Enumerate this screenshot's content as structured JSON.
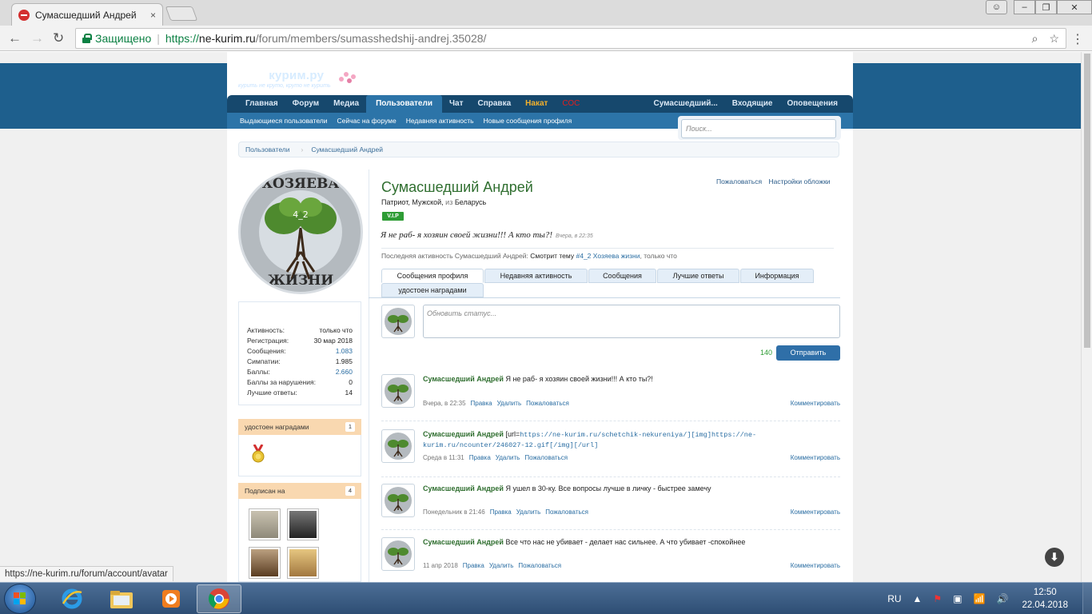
{
  "browser": {
    "tab_title": "Сумасшедший Андрей",
    "tab_close": "×",
    "secure_label": "Защищено",
    "url_scheme": "https://",
    "url_host": "ne-kurim.ru",
    "url_path": "/forum/members/sumasshedshij-andrej.35028/",
    "status_url": "https://ne-kurim.ru/forum/account/avatar"
  },
  "site": {
    "logo_text": "Не",
    "logo_text2": "курим.ру",
    "logo_tagline": "курить не круто, круто не курить",
    "nav": [
      "Главная",
      "Форум",
      "Медиа",
      "Пользователи",
      "Чат",
      "Справка",
      "Накат",
      "СОС"
    ],
    "nav_right": [
      "Сумасшедший...",
      "Входящие",
      "Оповещения"
    ],
    "subnav": [
      "Выдающиеся пользователи",
      "Сейчас на форуме",
      "Недавняя активность",
      "Новые сообщения профиля"
    ],
    "search_placeholder": "Поиск...",
    "breadcrumb": [
      "Пользователи",
      "Сумасшедший Андрей"
    ]
  },
  "sidebar": {
    "avatar_text_top": "ХОЗЯЕВА",
    "avatar_text_bottom": "ЖИЗНИ",
    "avatar_text_mid": "4_2",
    "stats": [
      {
        "label": "Активность:",
        "value": "только что"
      },
      {
        "label": "Регистрация:",
        "value": "30 мар 2018"
      },
      {
        "label": "Сообщения:",
        "value": "1.083"
      },
      {
        "label": "Симпатии:",
        "value": "1.985"
      },
      {
        "label": "Баллы:",
        "value": "2.660"
      },
      {
        "label": "Баллы за нарушения:",
        "value": "0"
      },
      {
        "label": "Лучшие ответы:",
        "value": "14"
      }
    ],
    "awards_title": "удостоен наградами",
    "awards_count": "1",
    "following_title": "Подписан на",
    "following_count": "4"
  },
  "profile": {
    "name": "Сумасшедший Андрей",
    "sub_title": "Патриот, Мужской,",
    "sub_from": "из",
    "sub_country": "Беларусь",
    "badge": "V.I.P",
    "report": "Пожаловаться",
    "cover_settings": "Настройки обложки",
    "status": "Я не раб- я хозяин своей жизни!!! А кто ты?!",
    "status_time": "Вчера, в 22:35",
    "last_activity_prefix": "Последняя активность Сумасшедший Андрей:",
    "last_activity_action": "Смотрит тему",
    "last_activity_topic": "#4_2 Хозяева жизни",
    "last_activity_suffix": ", только что",
    "tabs": [
      "Сообщения профиля",
      "Недавняя активность",
      "Сообщения",
      "Лучшие ответы",
      "Информация",
      "удостоен наградами"
    ],
    "status_placeholder": "Обновить статус...",
    "char_count": "140",
    "send_label": "Отправить"
  },
  "posts": [
    {
      "author": "Сумасшедший Андрей",
      "text": "Я не раб- я хозяин своей жизни!!! А кто ты?!",
      "time": "Вчера, в 22:35",
      "edit": "Правка",
      "delete": "Удалить",
      "report": "Пожаловаться",
      "comment": "Комментировать"
    },
    {
      "author": "Сумасшедший Андрей",
      "text": "[url=",
      "link": "https://ne-kurim.ru/schetchik-nekureniya/][img]https://ne-kurim.ru/ncounter/246027-12.gif[/img][/url]",
      "time": "Среда в 11:31",
      "edit": "Правка",
      "delete": "Удалить",
      "report": "Пожаловаться",
      "comment": "Комментировать"
    },
    {
      "author": "Сумасшедший Андрей",
      "text": "Я ушел в 30-ку. Все вопросы лучше в личку - быстрее замечу",
      "time": "Понедельник в 21:46",
      "edit": "Правка",
      "delete": "Удалить",
      "report": "Пожаловаться",
      "comment": "Комментировать"
    },
    {
      "author": "Сумасшедший Андрей",
      "text": "Все что нас не убивает - делает нас сильнее. А что убивает -спокойнее",
      "time": "11 апр 2018",
      "edit": "Правка",
      "delete": "Удалить",
      "report": "Пожаловаться",
      "comment": "Комментировать"
    }
  ],
  "taskbar": {
    "lang": "RU",
    "time": "12:50",
    "date": "22.04.2018"
  }
}
